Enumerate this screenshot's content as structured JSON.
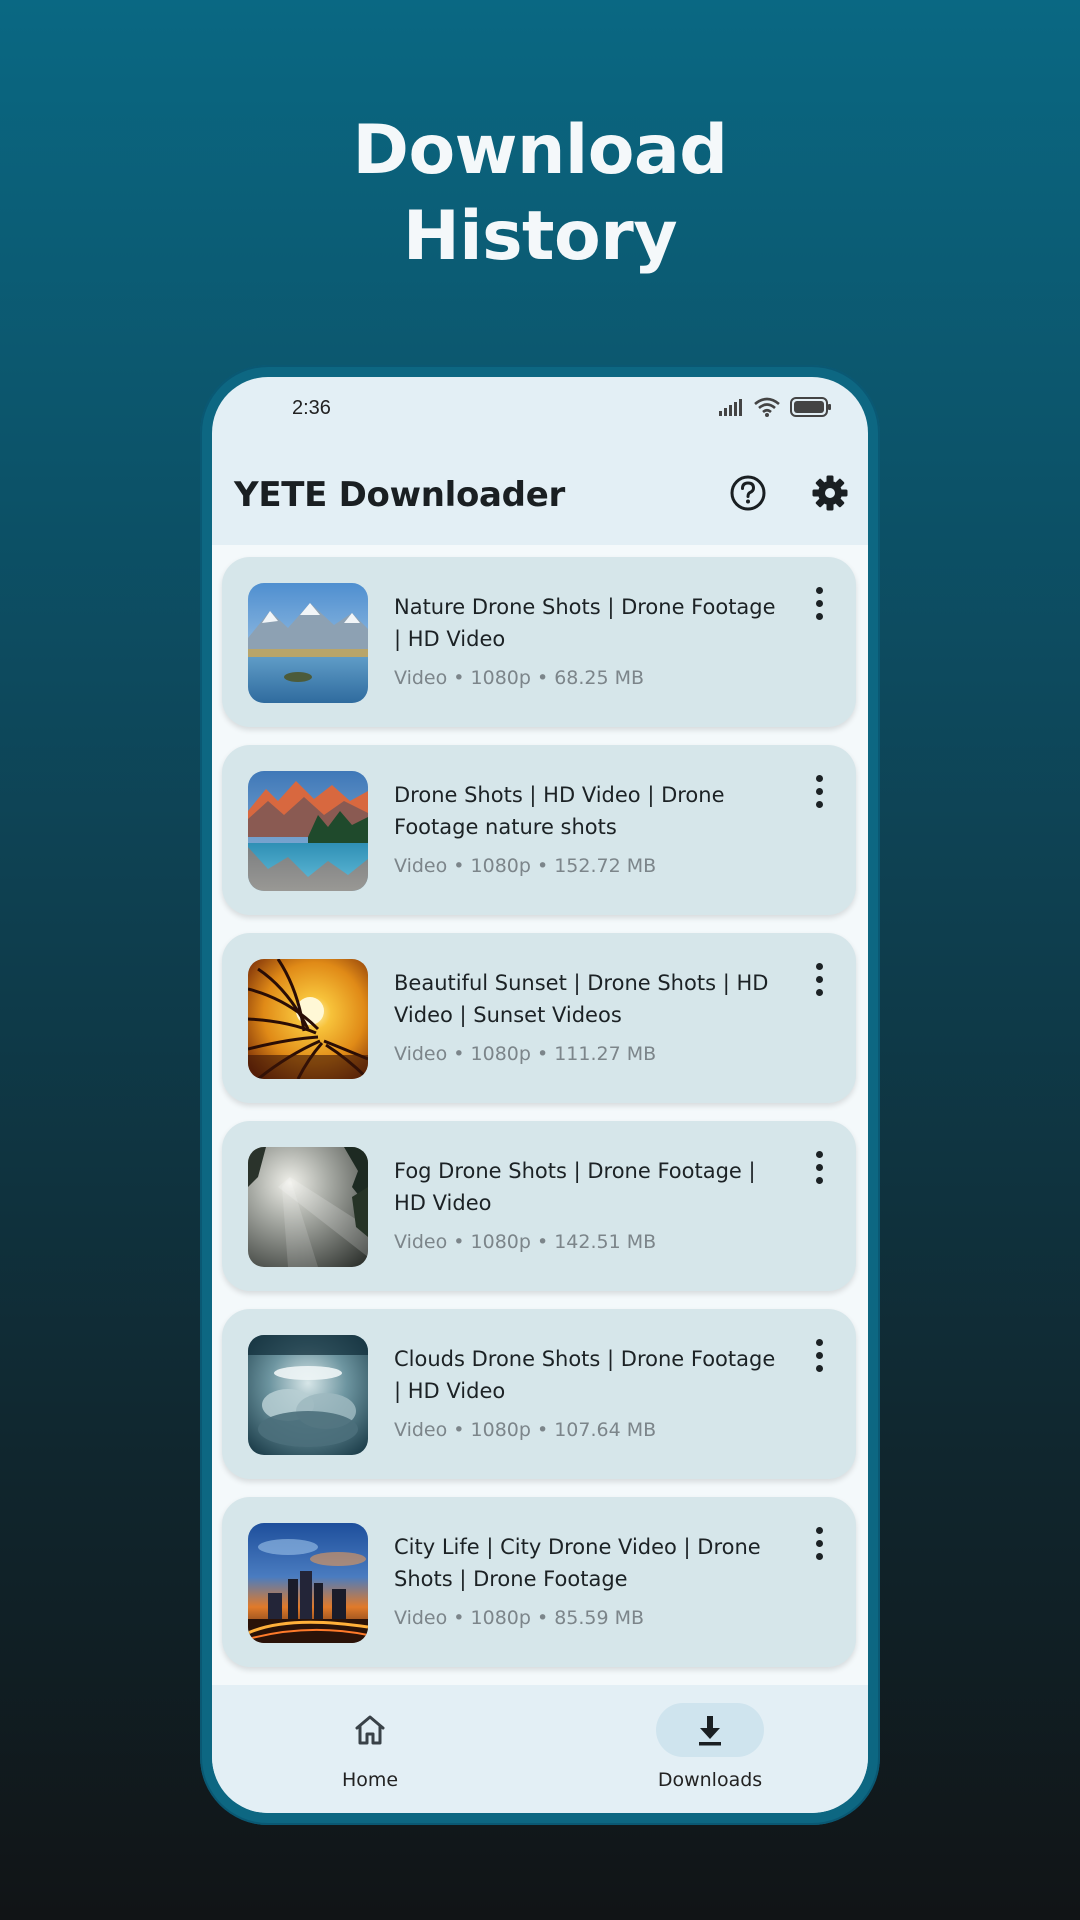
{
  "headline": {
    "line1": "Download",
    "line2": "History"
  },
  "status_bar": {
    "time": "2:36",
    "icons": [
      "signal-icon",
      "wifi-icon",
      "battery-icon"
    ]
  },
  "app_bar": {
    "title": "YETE Downloader",
    "actions": [
      "help-icon",
      "gear-icon"
    ]
  },
  "downloads": [
    {
      "title": "Nature Drone Shots | Drone Footage | HD Video",
      "meta": "Video • 1080p • 68.25 MB",
      "thumbnail": "mountain-lake"
    },
    {
      "title": "Drone Shots | HD Video | Drone Footage nature shots",
      "meta": "Video • 1080p • 152.72 MB",
      "thumbnail": "alpine-lake"
    },
    {
      "title": "Beautiful Sunset | Drone Shots | HD Video | Sunset Videos",
      "meta": "Video • 1080p • 111.27 MB",
      "thumbnail": "sunset-palm"
    },
    {
      "title": "Fog Drone Shots | Drone Footage | HD Video",
      "meta": "Video • 1080p • 142.51 MB",
      "thumbnail": "fog-forest"
    },
    {
      "title": "Clouds Drone Shots | Drone Footage | HD Video",
      "meta": "Video • 1080p • 107.64 MB",
      "thumbnail": "clouds"
    },
    {
      "title": "City Life | City Drone Video | Drone Shots | Drone Footage",
      "meta": "Video • 1080p • 85.59 MB",
      "thumbnail": "city-night"
    }
  ],
  "bottom_nav": {
    "items": [
      {
        "label": "Home",
        "icon": "home-icon",
        "active": false
      },
      {
        "label": "Downloads",
        "icon": "download-icon",
        "active": true
      }
    ]
  },
  "colors": {
    "accent": "#0d6782",
    "card_bg": "#d6e6ea",
    "screen_bg": "#e3eff5",
    "meta_text": "#7c858a"
  }
}
